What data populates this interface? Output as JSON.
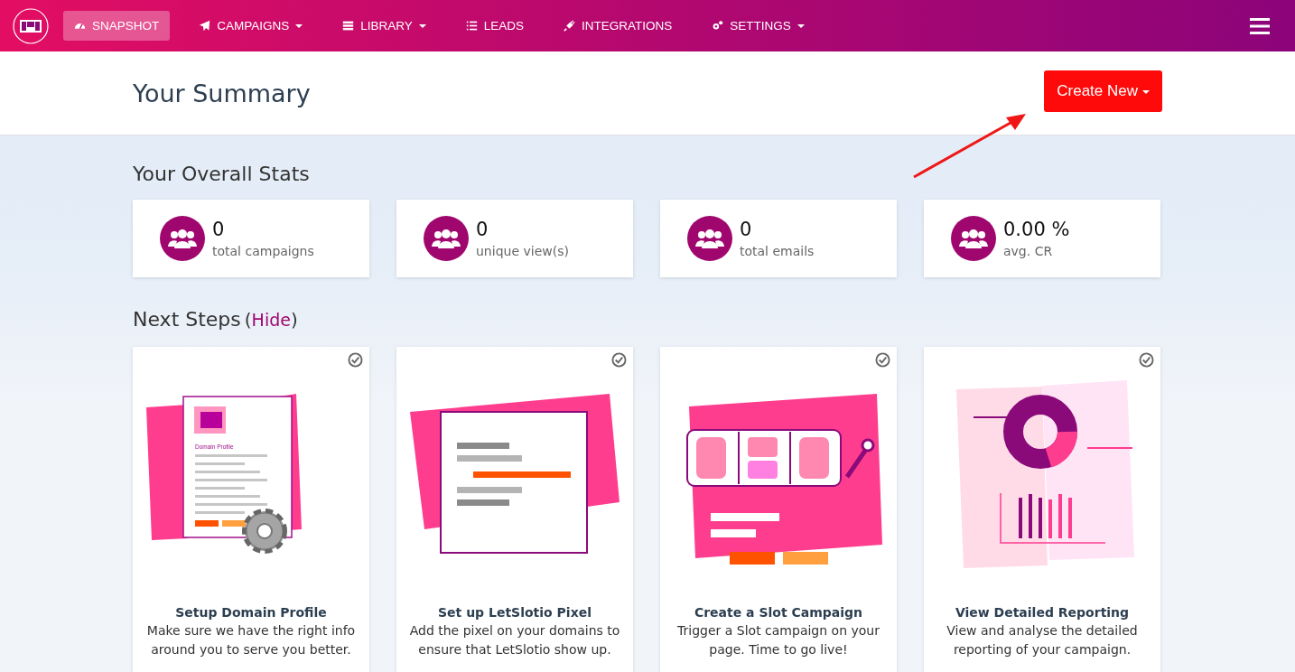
{
  "nav": {
    "items": [
      {
        "label": "SNAPSHOT",
        "dropdown": false,
        "selected": true
      },
      {
        "label": "CAMPAIGNS",
        "dropdown": true,
        "selected": false
      },
      {
        "label": "LIBRARY",
        "dropdown": true,
        "selected": false
      },
      {
        "label": "LEADS",
        "dropdown": false,
        "selected": false
      },
      {
        "label": "INTEGRATIONS",
        "dropdown": false,
        "selected": false
      },
      {
        "label": "SETTINGS",
        "dropdown": true,
        "selected": false
      }
    ]
  },
  "header": {
    "title": "Your Summary",
    "create_button": "Create New"
  },
  "stats": {
    "title": "Your Overall Stats",
    "cards": [
      {
        "value": "0",
        "label": "total campaigns"
      },
      {
        "value": "0",
        "label": "unique view(s)"
      },
      {
        "value": "0",
        "label": "total emails"
      },
      {
        "value": "0.00 %",
        "label": "avg. CR"
      }
    ]
  },
  "next_steps": {
    "title": "Next Steps",
    "hide_open": "(",
    "hide_link": "Hide",
    "hide_close": ")",
    "cards": [
      {
        "kind": "domain",
        "illustration_text": "Domain Profile",
        "title": "Setup Domain Profile",
        "text": "Make sure we have the right info around you to serve you better."
      },
      {
        "kind": "pixel",
        "title": "Set up LetSlotio Pixel",
        "text": "Add the pixel on your domains to ensure that LetSlotio show up."
      },
      {
        "kind": "slot",
        "title": "Create a Slot Campaign",
        "text": "Trigger a Slot campaign on your page. Time to go live!"
      },
      {
        "kind": "reporting",
        "title": "View Detailed Reporting",
        "text": "View and analyse the detailed reporting of your campaign."
      }
    ]
  }
}
